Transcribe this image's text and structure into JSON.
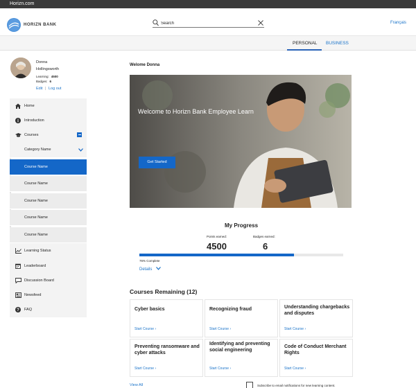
{
  "browser": {
    "tab_title": "Horizn.com"
  },
  "header": {
    "brand": "HORIZN BANK",
    "search_placeholder": "Search",
    "language_link": "Français"
  },
  "tabs": [
    {
      "label": "PERSONAL",
      "active": true
    },
    {
      "label": "BUSINESS",
      "active": false
    }
  ],
  "profile": {
    "first_name": "Donna",
    "last_name": "Hollingsworth",
    "learning_label": "Learning:",
    "learning_value": "4500",
    "badges_label": "Badges:",
    "badges_value": "6",
    "edit_link": "Edit",
    "separator": "|",
    "logout_link": "Log out"
  },
  "sidebar": {
    "items": [
      {
        "label": "Home",
        "icon": "home-icon"
      },
      {
        "label": "Introduction",
        "icon": "info-icon"
      },
      {
        "label": "Courses",
        "icon": "graduation-cap-icon"
      },
      {
        "label": "Category Name",
        "icon": "chevron-down-icon"
      },
      {
        "label": "Course Name",
        "active": true
      },
      {
        "label": "Course Name"
      },
      {
        "label": "Course Name"
      },
      {
        "label": "Course Name"
      },
      {
        "label": "Course Name"
      },
      {
        "label": "Learning Status",
        "icon": "line-chart-icon"
      },
      {
        "label": "Leaderboard",
        "icon": "calendar-icon"
      },
      {
        "label": "Discussion Board",
        "icon": "comment-icon"
      },
      {
        "label": "Newsfeed",
        "icon": "newspaper-icon"
      },
      {
        "label": "FAQ",
        "icon": "question-icon"
      }
    ]
  },
  "main": {
    "welcome": "Welome Donna",
    "hero": {
      "title": "Welcome to Horizn Bank Employee Learn",
      "button": "Get Started"
    },
    "progress": {
      "title": "My Progress",
      "points_label": "Points earned:",
      "points_value": "4500",
      "badges_label": "Badges earned:",
      "badges_value": "6",
      "percent": 76,
      "percent_text": "76% Complete",
      "details_link": "Details"
    },
    "courses": {
      "title": "Courses Remaining (12)",
      "start_label": "Start Course  ›",
      "items": [
        {
          "title": "Cyber basics"
        },
        {
          "title": "Recognizing fraud"
        },
        {
          "title": "Understanding chargebacks and disputes"
        },
        {
          "title": "Preventing ransomware and cyber attacks"
        },
        {
          "title": "Identifying and preventing social engineering"
        },
        {
          "title": "Code of Conduct Merchant Rights"
        }
      ]
    },
    "footer": {
      "view_all": "View All",
      "subscribe_label": "Subscribe to email notifications for new learning content."
    }
  },
  "colors": {
    "accent": "#1467c8",
    "link": "#1a73c9"
  }
}
